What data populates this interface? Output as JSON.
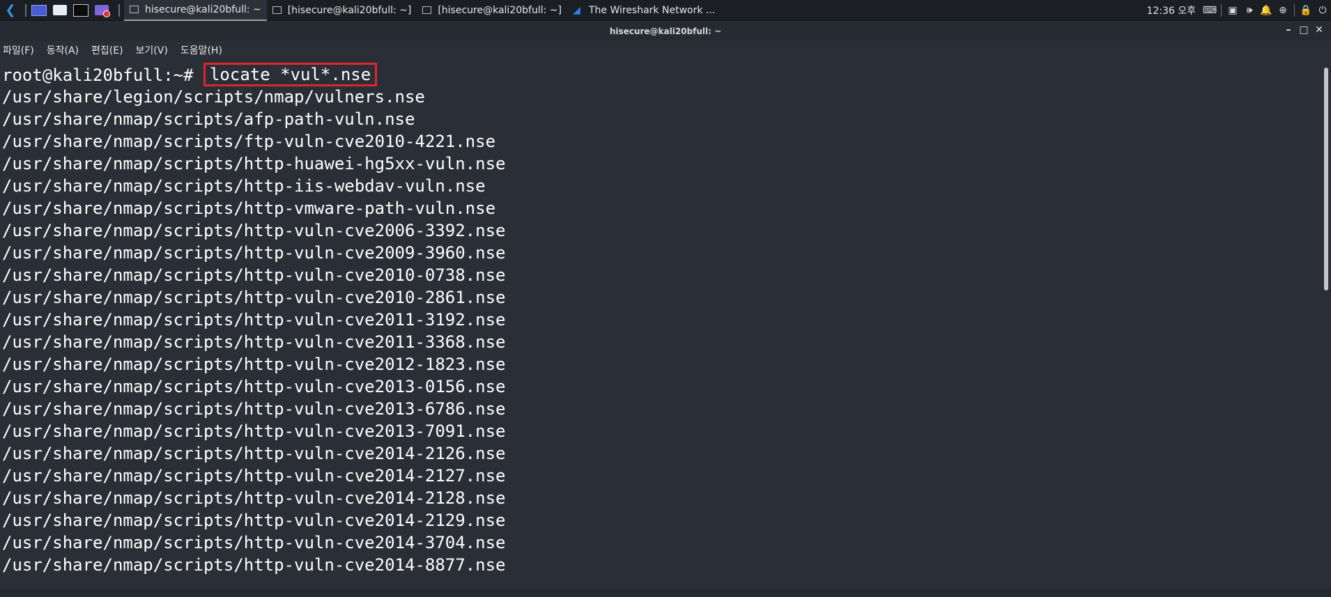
{
  "taskbar": {
    "tasks": [
      {
        "label": "hisecure@kali20bfull: ~",
        "active": true,
        "icon": "terminal-icon"
      },
      {
        "label": "[hisecure@kali20bfull: ~]",
        "active": false,
        "icon": "terminal-icon"
      },
      {
        "label": "[hisecure@kali20bfull: ~]",
        "active": false,
        "icon": "terminal-icon"
      },
      {
        "label": "The Wireshark Network ...",
        "active": false,
        "icon": "wireshark-icon"
      }
    ],
    "clock": "12:36 오후"
  },
  "window": {
    "title": "hisecure@kali20bfull: ~",
    "minimize_glyph": "–",
    "maximize_glyph": "□",
    "close_glyph": "✕"
  },
  "menubar": {
    "items": [
      "파일(F)",
      "동작(A)",
      "편집(E)",
      "보기(V)",
      "도움말(H)"
    ]
  },
  "terminal": {
    "prompt": "root@kali20bfull:~# ",
    "command": "locate *vul*.nse",
    "output": [
      "/usr/share/legion/scripts/nmap/vulners.nse",
      "/usr/share/nmap/scripts/afp-path-vuln.nse",
      "/usr/share/nmap/scripts/ftp-vuln-cve2010-4221.nse",
      "/usr/share/nmap/scripts/http-huawei-hg5xx-vuln.nse",
      "/usr/share/nmap/scripts/http-iis-webdav-vuln.nse",
      "/usr/share/nmap/scripts/http-vmware-path-vuln.nse",
      "/usr/share/nmap/scripts/http-vuln-cve2006-3392.nse",
      "/usr/share/nmap/scripts/http-vuln-cve2009-3960.nse",
      "/usr/share/nmap/scripts/http-vuln-cve2010-0738.nse",
      "/usr/share/nmap/scripts/http-vuln-cve2010-2861.nse",
      "/usr/share/nmap/scripts/http-vuln-cve2011-3192.nse",
      "/usr/share/nmap/scripts/http-vuln-cve2011-3368.nse",
      "/usr/share/nmap/scripts/http-vuln-cve2012-1823.nse",
      "/usr/share/nmap/scripts/http-vuln-cve2013-0156.nse",
      "/usr/share/nmap/scripts/http-vuln-cve2013-6786.nse",
      "/usr/share/nmap/scripts/http-vuln-cve2013-7091.nse",
      "/usr/share/nmap/scripts/http-vuln-cve2014-2126.nse",
      "/usr/share/nmap/scripts/http-vuln-cve2014-2127.nse",
      "/usr/share/nmap/scripts/http-vuln-cve2014-2128.nse",
      "/usr/share/nmap/scripts/http-vuln-cve2014-2129.nse",
      "/usr/share/nmap/scripts/http-vuln-cve2014-3704.nse",
      "/usr/share/nmap/scripts/http-vuln-cve2014-8877.nse"
    ]
  },
  "colors": {
    "background": "#2a2e36",
    "text": "#ffffff",
    "highlight_box": "#e0262b"
  }
}
